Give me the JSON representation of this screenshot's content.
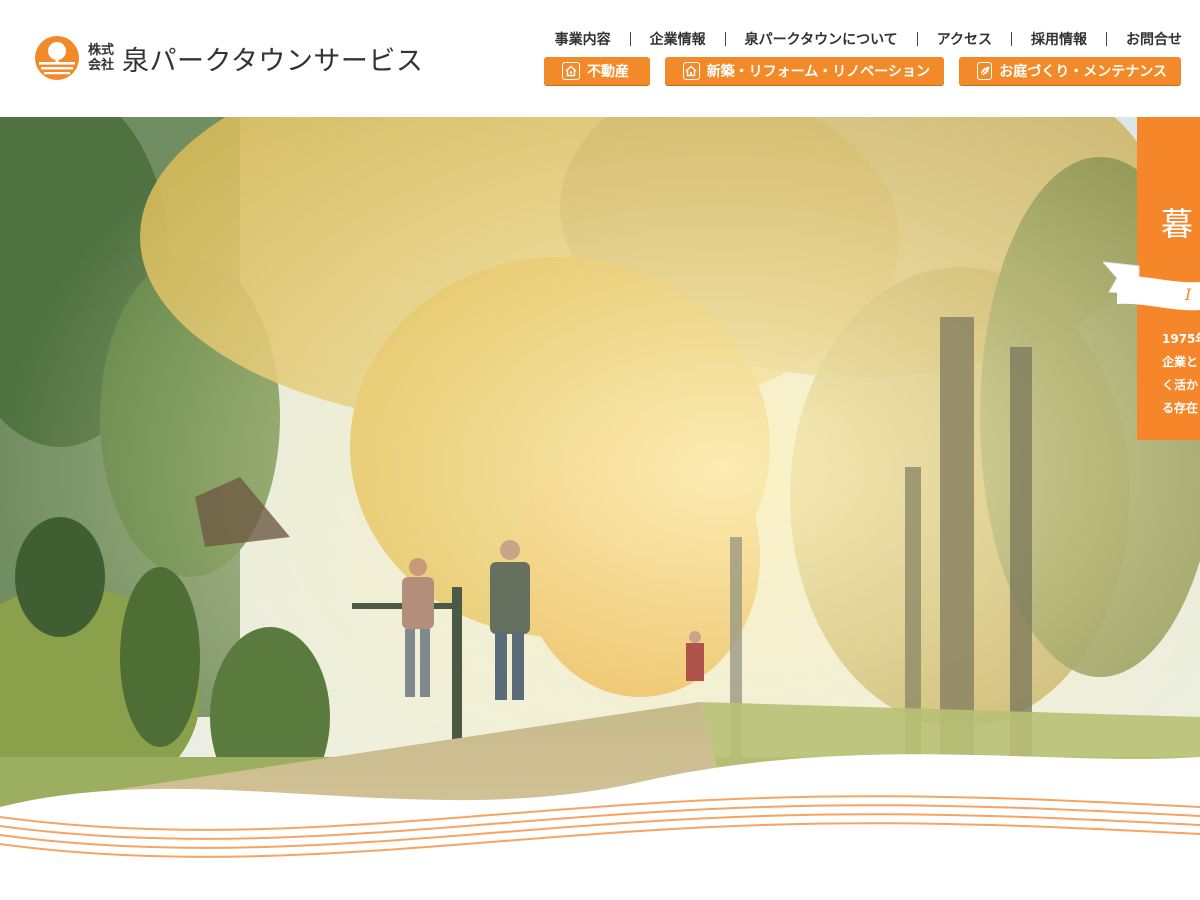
{
  "brand": {
    "corp_line1": "株式",
    "corp_line2": "会社",
    "name": "泉パークタウンサービス",
    "logo_icon": "tree-sun-icon",
    "accent": "#f38a2a"
  },
  "top_nav": [
    {
      "label": "事業内容"
    },
    {
      "label": "企業情報"
    },
    {
      "label": "泉パークタウンについて"
    },
    {
      "label": "アクセス"
    },
    {
      "label": "採用情報"
    },
    {
      "label": "お問合せ"
    }
  ],
  "sub_nav": [
    {
      "label": "不動産",
      "icon": "house-key-icon"
    },
    {
      "label": "新築・リフォーム・リノベーション",
      "icon": "house-icon"
    },
    {
      "label": "お庭づくり・メンテナンス",
      "icon": "leaf-icon"
    }
  ],
  "hero": {
    "image": "autumn-tree-lined-path-with-walkers",
    "side_card": {
      "heading": "暮",
      "ribbon_text": "I",
      "lines": [
        "1975年",
        "企業と",
        "く活か",
        "る存在"
      ]
    }
  }
}
